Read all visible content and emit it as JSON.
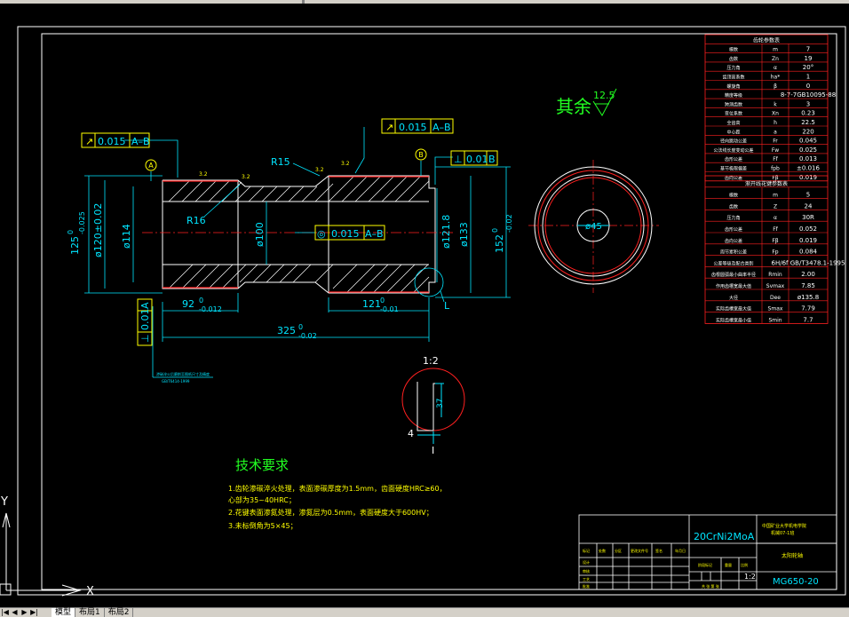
{
  "tabs": {
    "model": "模型",
    "layout1": "布局1",
    "layout2": "布局2"
  },
  "nav_glyphs": [
    "|◀",
    "◀",
    "▶",
    "▶|"
  ],
  "ucs": {
    "x": "X",
    "y": "Y"
  },
  "colors": {
    "background": "#000000",
    "frame": "#ffffff",
    "red": "#ff2020",
    "cyan": "#00e5ff",
    "green": "#22ff22",
    "yellow": "#ffff00"
  },
  "drawing": {
    "material_top": "20CrNi2MoA",
    "finish_symbol": {
      "prefix": "其余",
      "value": "12.5"
    },
    "tolerance_frames": [
      {
        "symbol": "↗",
        "value": "0.015",
        "datum": "A–B"
      },
      {
        "symbol": "↗",
        "value": "0.015",
        "datum": "A–B"
      },
      {
        "symbol": "⊥",
        "value": "0.01",
        "datum": "B"
      },
      {
        "symbol": "◎",
        "value": "0.015",
        "datum": "A–B"
      },
      {
        "symbol": "⊥",
        "value": "0.01",
        "datum": "A"
      }
    ],
    "datums": [
      "A",
      "B"
    ],
    "dimensions": {
      "r15": "R15",
      "r16": "R16",
      "d125": "125",
      "d125_tol_upper": "0",
      "d125_tol_lower": "-0.025",
      "d120": "ø120±0.02",
      "d114": "ø114",
      "d100": "ø100",
      "d121_8": "ø121.8",
      "d133": "ø133",
      "d152": "152",
      "d152_tol_upper": "0",
      "d152_tol_lower": "-0.02",
      "l92": "92",
      "l92_tol_upper": "0",
      "l92_tol_lower": "-0.012",
      "l121": "121",
      "l121_tol_upper": "0",
      "l121_tol_lower": "-0.01",
      "l325": "325",
      "l325_tol_upper": "0",
      "l325_tol_lower": "-0.02",
      "hole": "ø45",
      "detail_l": "L",
      "detail_37": "37",
      "detail_4": "4",
      "detail_scale": "1:2",
      "detail_i": "I"
    },
    "rough_marks": [
      "3.2",
      "3.2",
      "3.2",
      "3.2"
    ],
    "note_small": "渗碳淬火后磨削至图纸尺寸及精度",
    "note_small2": "GB/T6414-1999"
  },
  "gear_table_1": {
    "title": "齿轮参数表",
    "rows": [
      [
        "模数",
        "m",
        "7"
      ],
      [
        "齿数",
        "Zn",
        "19"
      ],
      [
        "压力角",
        "α",
        "20°"
      ],
      [
        "齿顶高系数",
        "ha*",
        "1"
      ],
      [
        "螺旋角",
        "β",
        "0"
      ],
      [
        "精度等级",
        "",
        "8-7-7GB10095-88"
      ],
      [
        "跨测齿数",
        "k",
        "3"
      ],
      [
        "变位系数",
        "Xn",
        "0.23"
      ],
      [
        "全齿高",
        "h",
        "22.5"
      ],
      [
        "中心距",
        "a",
        "220"
      ],
      [
        "径向跳动公差",
        "Fr",
        "0.045"
      ],
      [
        "公法线长度变动公差",
        "Fw",
        "0.025"
      ],
      [
        "齿形公差",
        "Ff",
        "0.013"
      ],
      [
        "基节极限偏差",
        "fpb",
        "±0.016"
      ],
      [
        "齿向公差",
        "Fβ",
        "0.019"
      ]
    ]
  },
  "gear_table_2": {
    "title": "渐开线花键参数表",
    "rows": [
      [
        "模数",
        "m",
        "5"
      ],
      [
        "齿数",
        "Z",
        "24"
      ],
      [
        "压力角",
        "α",
        "30R"
      ],
      [
        "齿形公差",
        "Ff",
        "0.052"
      ],
      [
        "齿向公差",
        "Fβ",
        "0.019"
      ],
      [
        "周节累积公差",
        "Fp",
        "0.084"
      ],
      [
        "公差等级及配合类别",
        "",
        "6H/6f GB/T3478.1-1995"
      ],
      [
        "齿根圆弧最小曲率半径",
        "Rmin",
        "2.00"
      ],
      [
        "作用齿槽宽最大值",
        "Svmax",
        "7.85"
      ],
      [
        "大径",
        "Dee",
        "ø135.8"
      ],
      [
        "实际齿槽宽最大值",
        "Smax",
        "7.79"
      ],
      [
        "实际齿槽宽最小值",
        "Smin",
        "7.7"
      ]
    ]
  },
  "tech_requirements": {
    "title": "技术要求",
    "lines": [
      "1.齿轮渗碳淬火处理，表面渗碳厚度为1.5mm，齿面硬度HRC≥60，",
      "心部为35~40HRC；",
      "2.花键表面渗氮处理，渗氮层为0.5mm，表面硬度大于600HV；",
      "3.未标倒角为5×45；"
    ]
  },
  "title_block": {
    "material": "20CrNi2MoA",
    "school": "中国矿业大学机电学院",
    "class": "机械07-1班",
    "part_name": "太阳轮轴",
    "scale": "1:2",
    "drawing_no": "MG650-20",
    "header_cells": [
      "标记",
      "处数",
      "分区",
      "更改文件号",
      "签名",
      "年月日"
    ],
    "row_labels": [
      "设计",
      "审核",
      "工艺",
      "批准"
    ],
    "stage_labels": [
      "阶段标记",
      "重量",
      "比例"
    ],
    "sheet": "共 张 第 张"
  }
}
